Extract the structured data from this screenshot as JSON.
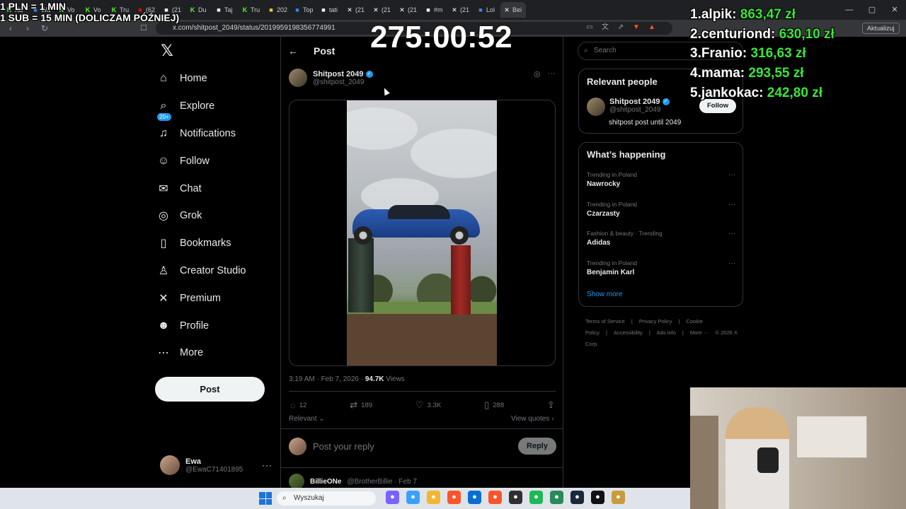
{
  "browser": {
    "tabs": [
      {
        "label": "Ka",
        "icon": "k-icon",
        "color": "#53fc18"
      },
      {
        "label": "Wa",
        "icon": "globe-icon",
        "color": "#3b82f6"
      },
      {
        "label": "Vo",
        "icon": "k-icon",
        "color": "#53fc18"
      },
      {
        "label": "Vo",
        "icon": "k-icon",
        "color": "#53fc18"
      },
      {
        "label": "Tru",
        "icon": "k-icon",
        "color": "#53fc18"
      },
      {
        "label": "(62",
        "icon": "youtube-icon",
        "color": "#ff0000"
      },
      {
        "label": "(21",
        "icon": "tiktok-icon",
        "color": "#ffffff"
      },
      {
        "label": "Du",
        "icon": "k-icon",
        "color": "#53fc18"
      },
      {
        "label": "Taj",
        "icon": "tiktok-icon",
        "color": "#ffffff"
      },
      {
        "label": "Tru",
        "icon": "k-icon",
        "color": "#53fc18"
      },
      {
        "label": "202",
        "icon": "doc-icon",
        "color": "#f4c542"
      },
      {
        "label": "Top",
        "icon": "wiki-icon",
        "color": "#3b82f6"
      },
      {
        "label": "tati",
        "icon": "tiktok-icon",
        "color": "#ffffff"
      },
      {
        "label": "(21",
        "icon": "x-icon",
        "color": "#ffffff"
      },
      {
        "label": "(21",
        "icon": "x-icon",
        "color": "#ffffff"
      },
      {
        "label": "(21",
        "icon": "x-icon",
        "color": "#ffffff"
      },
      {
        "label": "#m",
        "icon": "tiktok-icon",
        "color": "#ffffff"
      },
      {
        "label": "(21",
        "icon": "x-icon",
        "color": "#ffffff"
      },
      {
        "label": "Lol",
        "icon": "globe-icon",
        "color": "#3b82f6"
      },
      {
        "label": "Bei",
        "icon": "x-icon",
        "color": "#ffffff",
        "active": true
      }
    ],
    "url": "x.com/shitpost_2049/status/2019959198356774991",
    "update_label": "Aktualizuj"
  },
  "sidebar": {
    "items": [
      {
        "label": "Home",
        "icon": "home-icon",
        "glyph": "⌂"
      },
      {
        "label": "Explore",
        "icon": "search-icon",
        "glyph": "⌕"
      },
      {
        "label": "Notifications",
        "icon": "bell-icon",
        "glyph": "♫",
        "badge": "20+"
      },
      {
        "label": "Follow",
        "icon": "add-user-icon",
        "glyph": "☺"
      },
      {
        "label": "Chat",
        "icon": "mail-icon",
        "glyph": "✉"
      },
      {
        "label": "Grok",
        "icon": "grok-icon",
        "glyph": "◎"
      },
      {
        "label": "Bookmarks",
        "icon": "bookmark-icon",
        "glyph": "▯"
      },
      {
        "label": "Creator Studio",
        "icon": "creator-icon",
        "glyph": "♙"
      },
      {
        "label": "Premium",
        "icon": "x-premium-icon",
        "glyph": "✕"
      },
      {
        "label": "Profile",
        "icon": "profile-icon",
        "glyph": "☻"
      },
      {
        "label": "More",
        "icon": "more-circle-icon",
        "glyph": "⋯"
      }
    ],
    "post_label": "Post",
    "user": {
      "name": "Ewa",
      "handle": "@EwaC71401895"
    }
  },
  "post": {
    "header": "Post",
    "author_name": "Shitpost 2049",
    "author_handle": "@shitpost_2049",
    "time": "3:19 AM · Feb 7, 2026 · ",
    "views_count": "94.7K",
    "views_label": " Views",
    "stats": {
      "replies": "12",
      "reposts": "189",
      "likes": "3.3K",
      "bookmarks": "288"
    },
    "sort_label": "Relevant ⌄",
    "view_quotes": "View quotes ›",
    "reply_placeholder": "Post your reply",
    "reply_label": "Reply",
    "next_post": {
      "name": "BillieONe",
      "handle": "@BrotherBillie · Feb 7"
    }
  },
  "right": {
    "search_placeholder": "Search",
    "relevant_title": "Relevant people",
    "relevant": {
      "name": "Shitpost 2049",
      "handle": "@shitpost_2049",
      "bio": "shitpost post until 2049",
      "follow": "Follow"
    },
    "happening_title": "What’s happening",
    "trends": [
      {
        "context": "Trending in Poland",
        "name": "Nawrocky"
      },
      {
        "context": "Trending in Poland",
        "name": "Czarzasty"
      },
      {
        "context": "Fashion & beauty · Trending",
        "name": "Adidas"
      },
      {
        "context": "Trending in Poland",
        "name": "Benjamin Karl"
      }
    ],
    "show_more": "Show more",
    "footer": [
      "Terms of Service",
      "|",
      "Privacy Policy",
      "|",
      "Cookie Policy",
      "|",
      "Accessibility",
      "|",
      "Ads info",
      "|",
      "More ···",
      "© 2026 X Corp."
    ]
  },
  "overlay": {
    "rate_line1": "1 PLN = 1 MIN",
    "rate_line2": "1 SUB = 15 MIN (DOLICZAM PÓŹNIEJ)",
    "timer": "275:00:52",
    "leaderboard": [
      {
        "rank": "1.",
        "name": "alpik: ",
        "amount": "863,47 zł"
      },
      {
        "rank": "2.",
        "name": "centuriond: ",
        "amount": "630,10 zł"
      },
      {
        "rank": "3.",
        "name": "Franio: ",
        "amount": "316,63 zł"
      },
      {
        "rank": "4.",
        "name": "mama: ",
        "amount": "293,55 zł"
      },
      {
        "rank": "5.",
        "name": "jankokac: ",
        "amount": "242,80 zł"
      }
    ]
  },
  "taskbar": {
    "search_placeholder": "Wyszukaj",
    "apps": [
      {
        "icon": "copilot-icon",
        "color": "#7b61ff"
      },
      {
        "icon": "widgets-icon",
        "color": "#3aa0ff"
      },
      {
        "icon": "files-icon",
        "color": "#f2b632"
      },
      {
        "icon": "brave-icon",
        "color": "#fb542b"
      },
      {
        "icon": "store-icon",
        "color": "#0a6ed1"
      },
      {
        "icon": "brave-browser-icon",
        "color": "#fb542b"
      },
      {
        "icon": "obs-icon",
        "color": "#302e31"
      },
      {
        "icon": "spotify-icon",
        "color": "#1db954"
      },
      {
        "icon": "notepad-icon",
        "color": "#2a8a5a"
      },
      {
        "icon": "steam-icon",
        "color": "#1b2838"
      },
      {
        "icon": "capcut-icon",
        "color": "#111111"
      },
      {
        "icon": "league-icon",
        "color": "#c89b3c"
      }
    ]
  }
}
